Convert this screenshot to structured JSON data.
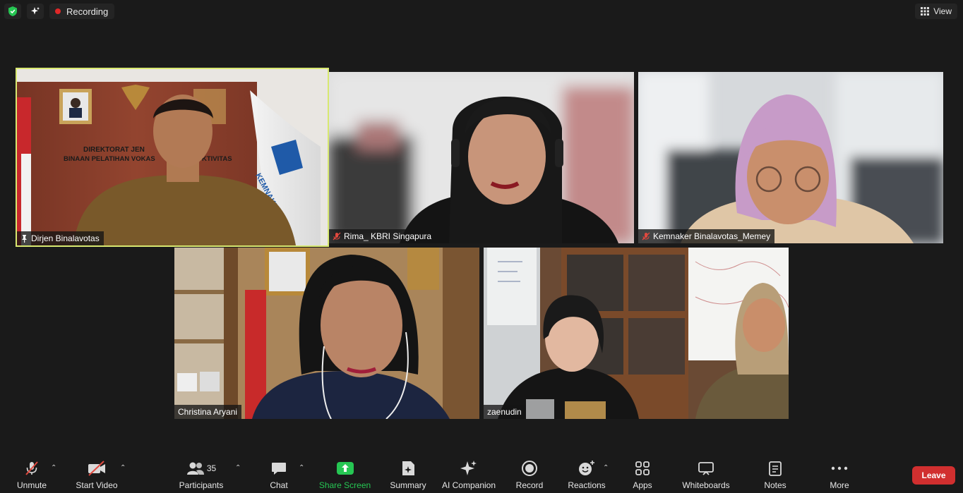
{
  "topbar": {
    "recording_label": "Recording",
    "view_label": "View",
    "security_icon": "shield-check-icon",
    "ai_icon": "sparkle-icon"
  },
  "colors": {
    "background": "#1a1a1a",
    "active_speaker": "#d8e870",
    "recording_dot": "#e02828",
    "share_green": "#26c653",
    "leave_red": "#d12f2f",
    "muted_red": "#e0483e"
  },
  "participants": [
    {
      "name": "Dirjen Binalavotas",
      "status_icon": "pin-icon",
      "active_speaker": true,
      "background_texts": [
        "DIREKTORAT JEN",
        "BINAAN PELATIHAN VOKAS",
        "KTIVITAS",
        "KEMNAKER"
      ]
    },
    {
      "name": "Rima_ KBRI Singapura",
      "status_icon": "mic-muted-icon",
      "active_speaker": false
    },
    {
      "name": "Kemnaker Binalavotas_Memey",
      "status_icon": "mic-muted-icon",
      "active_speaker": false
    },
    {
      "name": "Christina Aryani",
      "status_icon": "",
      "active_speaker": false
    },
    {
      "name": "zaenudin",
      "status_icon": "",
      "active_speaker": false
    }
  ],
  "toolbar": {
    "unmute": "Unmute",
    "start_video": "Start Video",
    "participants": "Participants",
    "participants_count": "35",
    "chat": "Chat",
    "share_screen": "Share Screen",
    "summary": "Summary",
    "ai_companion": "AI Companion",
    "record": "Record",
    "reactions": "Reactions",
    "apps": "Apps",
    "whiteboards": "Whiteboards",
    "notes": "Notes",
    "more": "More",
    "leave": "Leave"
  }
}
